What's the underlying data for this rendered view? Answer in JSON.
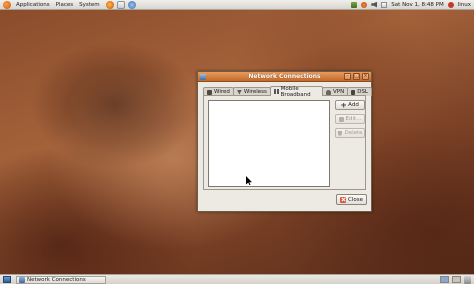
{
  "top_panel": {
    "menus": [
      "Applications",
      "Places",
      "System"
    ],
    "clock": "Sat Nov 1,  8:48 PM",
    "user": "linux"
  },
  "window": {
    "title": "Network Connections",
    "tabs": [
      {
        "label": "Wired",
        "icon": "wired-icon"
      },
      {
        "label": "Wireless",
        "icon": "wireless-icon"
      },
      {
        "label": "Mobile Broadband",
        "icon": "mobile-broadband-icon",
        "active": true
      },
      {
        "label": "VPN",
        "icon": "vpn-icon"
      },
      {
        "label": "DSL",
        "icon": "dsl-icon"
      }
    ],
    "buttons": {
      "add": "Add",
      "edit": "Edit...",
      "delete": "Delete",
      "close": "Close"
    }
  },
  "taskbar": {
    "items": [
      {
        "label": "Network Connections"
      }
    ]
  }
}
